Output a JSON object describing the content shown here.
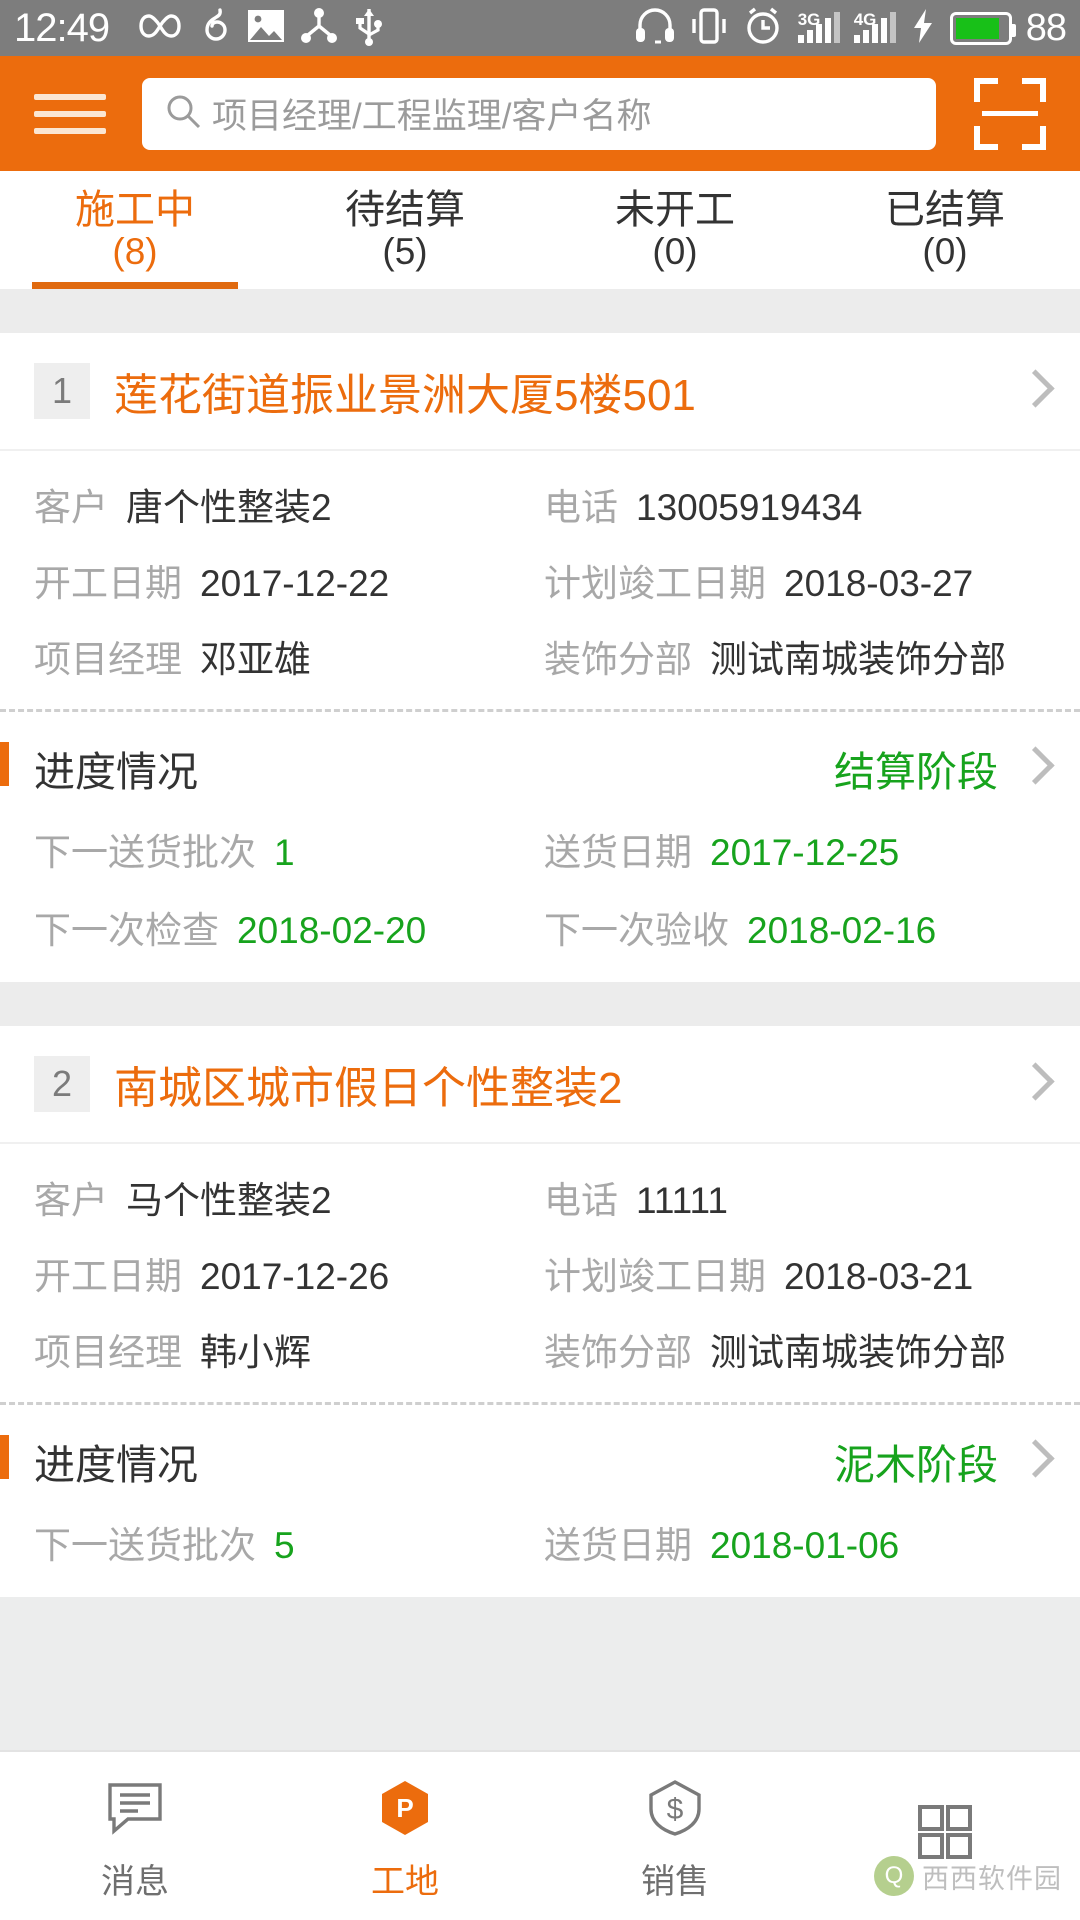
{
  "status_bar": {
    "time": "12:49",
    "battery_percent": "88",
    "left_icons": [
      "infinity-icon",
      "netease-music-icon",
      "image-icon",
      "share-icon",
      "usb-icon"
    ],
    "right_icons": [
      "headphones-icon",
      "vibrate-icon",
      "alarm-clock-icon",
      "signal-3g-icon",
      "signal-4g-icon",
      "charging-bolt-icon",
      "battery-icon"
    ],
    "network_labels": [
      "3G",
      "4G"
    ],
    "bg_color": "#7d7d7d",
    "battery_color": "#18c018"
  },
  "header": {
    "menu_icon": "hamburger-icon",
    "scan_icon": "scan-qr-icon",
    "search": {
      "value": "",
      "placeholder": "项目经理/工程监理/客户名称",
      "icon": "search-icon"
    },
    "bg_color": "#ec6c0d"
  },
  "tabs": {
    "active_index": 0,
    "accent_color": "#ec6c0d",
    "items": [
      {
        "label": "施工中",
        "count": "(8)"
      },
      {
        "label": "待结算",
        "count": "(5)"
      },
      {
        "label": "未开工",
        "count": "(0)"
      },
      {
        "label": "已结算",
        "count": "(0)"
      }
    ]
  },
  "labels": {
    "customer": "客户",
    "phone": "电话",
    "start_date": "开工日期",
    "planned_finish": "计划竣工日期",
    "project_manager": "项目经理",
    "decoration_branch": "装饰分部",
    "progress": "进度情况",
    "next_delivery_batch": "下一送货批次",
    "delivery_date": "送货日期",
    "next_inspection": "下一次检查",
    "next_acceptance": "下一次验收"
  },
  "colors": {
    "title": "#ec6c0d",
    "green": "#17a31d",
    "key": "#a8a8a8",
    "value": "#333333"
  },
  "projects": [
    {
      "index": "1",
      "title": "莲花街道振业景洲大厦5楼501",
      "customer": "唐个性整装2",
      "phone": "13005919434",
      "start_date": "2017-12-22",
      "planned_finish": "2018-03-27",
      "project_manager": "邓亚雄",
      "decoration_branch": "测试南城装饰分部",
      "stage": "结算阶段",
      "next_delivery_batch": "1",
      "delivery_date": "2017-12-25",
      "next_inspection": "2018-02-20",
      "next_acceptance": "2018-02-16"
    },
    {
      "index": "2",
      "title": "南城区城市假日个性整装2",
      "customer": "马个性整装2",
      "phone": "11111",
      "start_date": "2017-12-26",
      "planned_finish": "2018-03-21",
      "project_manager": "韩小辉",
      "decoration_branch": "测试南城装饰分部",
      "stage": "泥木阶段",
      "next_delivery_batch": "5",
      "delivery_date": "2018-01-06",
      "next_inspection": "",
      "next_acceptance": ""
    }
  ],
  "bottom_nav": {
    "active_index": 1,
    "items": [
      {
        "label": "消息",
        "icon": "message-lines-icon"
      },
      {
        "label": "工地",
        "icon": "site-p-badge-icon"
      },
      {
        "label": "销售",
        "icon": "sales-tag-icon"
      },
      {
        "label": "",
        "icon": "grid-squares-icon"
      }
    ]
  },
  "watermark": {
    "text": "西西软件园",
    "mark": "Q"
  }
}
